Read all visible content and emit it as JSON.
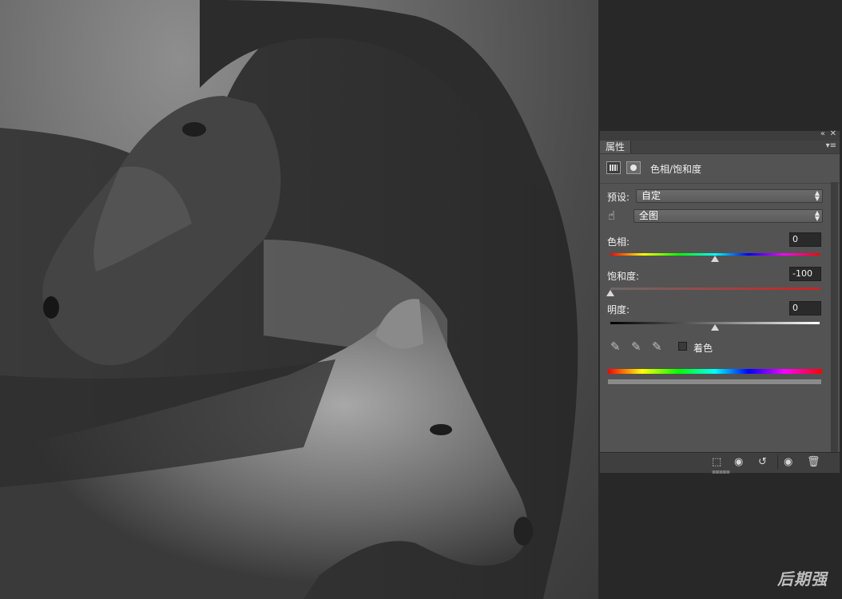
{
  "panel": {
    "tab_label": "属性",
    "title": "色相/饱和度",
    "preset": {
      "label": "预设:",
      "value": "自定"
    },
    "channel": {
      "value": "全图"
    },
    "hue": {
      "label": "色相:",
      "value": "0",
      "level": 0.5
    },
    "saturation": {
      "label": "饱和度:",
      "value": "-100",
      "level": 0.0
    },
    "lightness": {
      "label": "明度:",
      "value": "0",
      "level": 0.5
    },
    "colorize": {
      "label": "着色",
      "checked": false
    }
  },
  "icons": {
    "collapse": "«",
    "close": "✕",
    "menu": "▾≡",
    "hand": "☝",
    "eyedropper": "✎",
    "eye": "◉",
    "reset": "↺",
    "trash": "🗑"
  },
  "watermark": "后期强"
}
